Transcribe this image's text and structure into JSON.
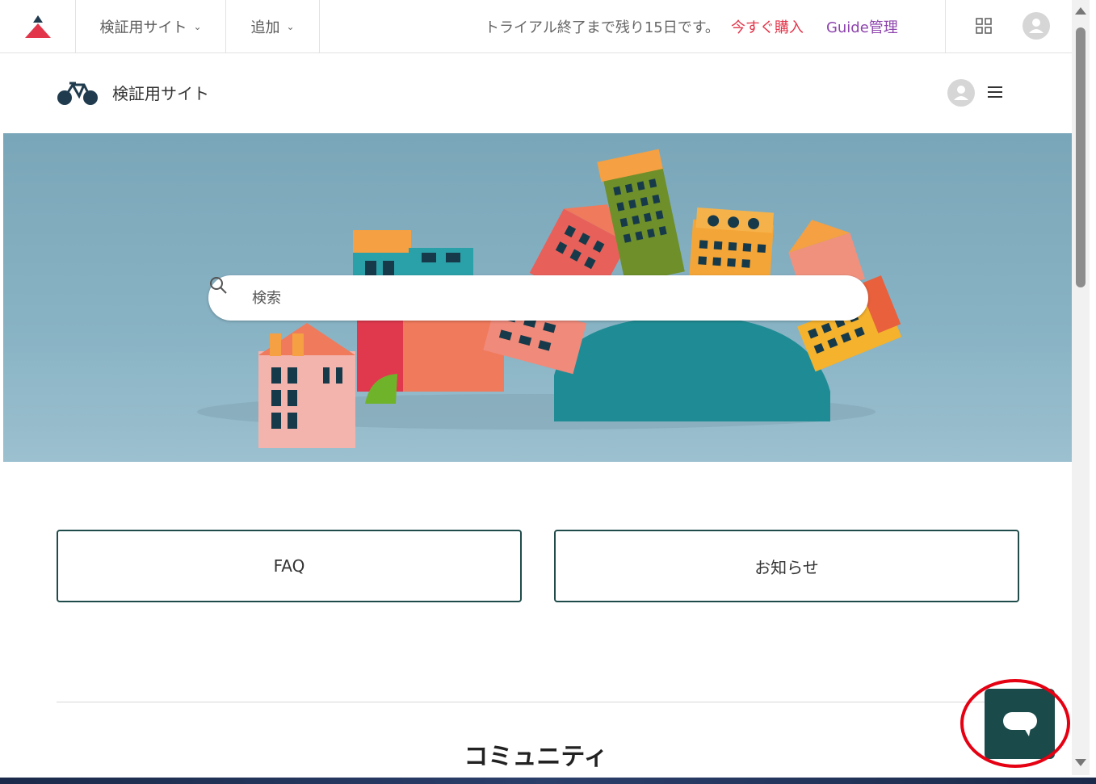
{
  "topbar": {
    "site_menu_label": "検証用サイト",
    "add_menu_label": "追加",
    "trial_text": "トライアル終了まで残り15日です。",
    "buy_link": "今すぐ購入",
    "guide_admin_link": "Guide管理"
  },
  "site_header": {
    "brand_name": "検証用サイト"
  },
  "search": {
    "placeholder": "検索"
  },
  "categories": [
    {
      "label": "FAQ"
    },
    {
      "label": "お知らせ"
    }
  ],
  "community": {
    "title": "コミュニティ"
  },
  "colors": {
    "accent_red": "#e2354a",
    "guide_purple": "#8e44ad",
    "brand_dark": "#1a4a4a",
    "highlight": "#e50012"
  },
  "icons": {
    "product_logo": "triangle-logo-icon",
    "apps": "grid-apps-icon",
    "user": "user-avatar-icon",
    "menu": "hamburger-menu-icon",
    "search": "search-icon",
    "chat": "chat-bubble-icon"
  }
}
